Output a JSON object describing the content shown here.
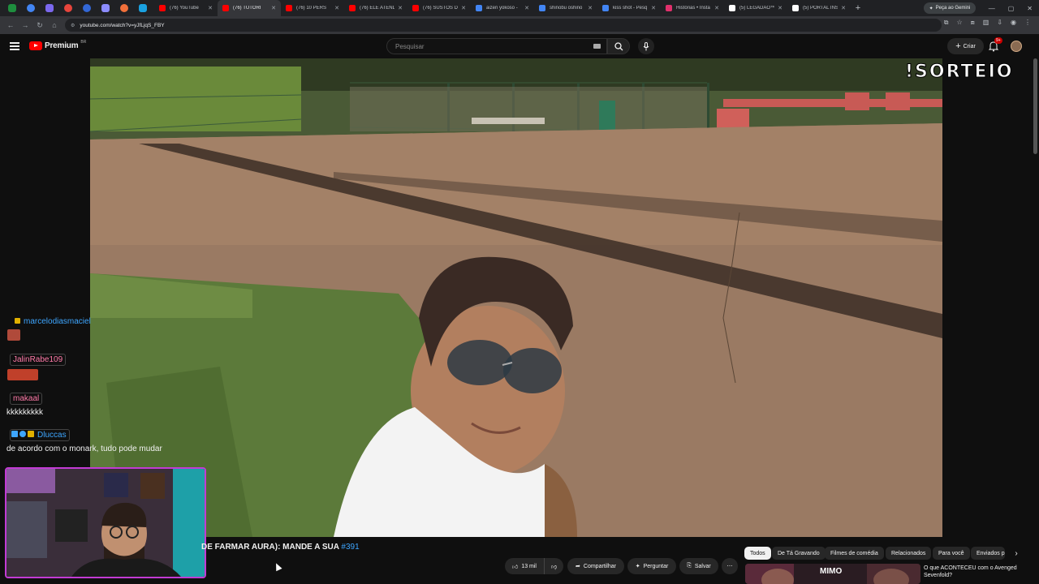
{
  "browser": {
    "tabs": [
      {
        "label": "(76) YouTube",
        "color": "#ff0000"
      },
      {
        "label": "(76) TUTORI",
        "color": "#ff0000",
        "active": true
      },
      {
        "label": "(76) 10 PERS",
        "color": "#ff0000"
      },
      {
        "label": "(76) ELE ATEND",
        "color": "#ff0000"
      },
      {
        "label": "(76) SUSTOS D",
        "color": "#ff0000"
      },
      {
        "label": "aizen yokoso -",
        "color": "#4285f4"
      },
      {
        "label": "shinobu oshino",
        "color": "#4285f4"
      },
      {
        "label": "kiss shot - Pesq",
        "color": "#4285f4"
      },
      {
        "label": "Histórias • Insta",
        "color": "#e1306c"
      },
      {
        "label": "(5) LEGADÃO™",
        "color": "#ffffff"
      },
      {
        "label": "(5) PORTAL INS",
        "color": "#ffffff"
      }
    ],
    "gemini_label": "Peça ao Gemini",
    "url": "youtube.com/watch?v=yJfLjqS_FBY"
  },
  "youtube": {
    "logo_text": "Premium",
    "logo_region": "BR",
    "search_placeholder": "Pesquisar",
    "create_label": "Criar",
    "notif_count": "9+"
  },
  "video": {
    "overlay_text": "!SORTEIO",
    "title": "DE FARMAR AURA): MANDE A SUA",
    "title_hashtag": "#391"
  },
  "chat": [
    {
      "user": "marcelodiasmaciel",
      "text": "",
      "color": "#3ea6ff"
    },
    {
      "user": "JalinRabe109",
      "text": "",
      "color": "#ff7aa8"
    },
    {
      "user": "makaal",
      "text": "kkkkkkkkk",
      "color": "#ff7aa8"
    },
    {
      "user": "Dluccas",
      "text": "de acordo com o monark, tudo pode mudar",
      "color": "#3ea6ff"
    }
  ],
  "actions": {
    "likes": "13 mil",
    "share": "Compartilhar",
    "ask": "Perguntar",
    "save": "Salvar"
  },
  "chips": [
    "Todos",
    "De Tá Gravando",
    "Filmes de comédia",
    "Relacionados",
    "Para você",
    "Enviados p"
  ],
  "related": {
    "thumb_text": "MIMO",
    "title": "O que ACONTECEU com o Avenged Sevenfold?"
  }
}
